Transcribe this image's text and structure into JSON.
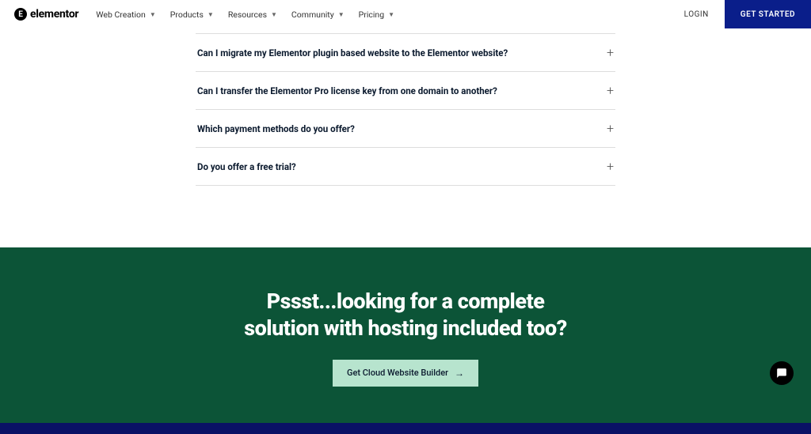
{
  "header": {
    "logo_text": "elementor",
    "nav": [
      {
        "label": "Web Creation"
      },
      {
        "label": "Products"
      },
      {
        "label": "Resources"
      },
      {
        "label": "Community"
      },
      {
        "label": "Pricing"
      }
    ],
    "login": "LOGIN",
    "get_started": "GET STARTED"
  },
  "faq": [
    {
      "q": "Can I migrate my Elementor plugin based website to the Elementor website?"
    },
    {
      "q": "Can I transfer the Elementor Pro license key from one domain to another?"
    },
    {
      "q": "Which payment methods do you offer?"
    },
    {
      "q": "Do you offer a free trial?"
    }
  ],
  "promo": {
    "line1": "Pssst...looking for a complete",
    "line2": "solution with hosting included too?",
    "cta": "Get Cloud Website Builder"
  }
}
